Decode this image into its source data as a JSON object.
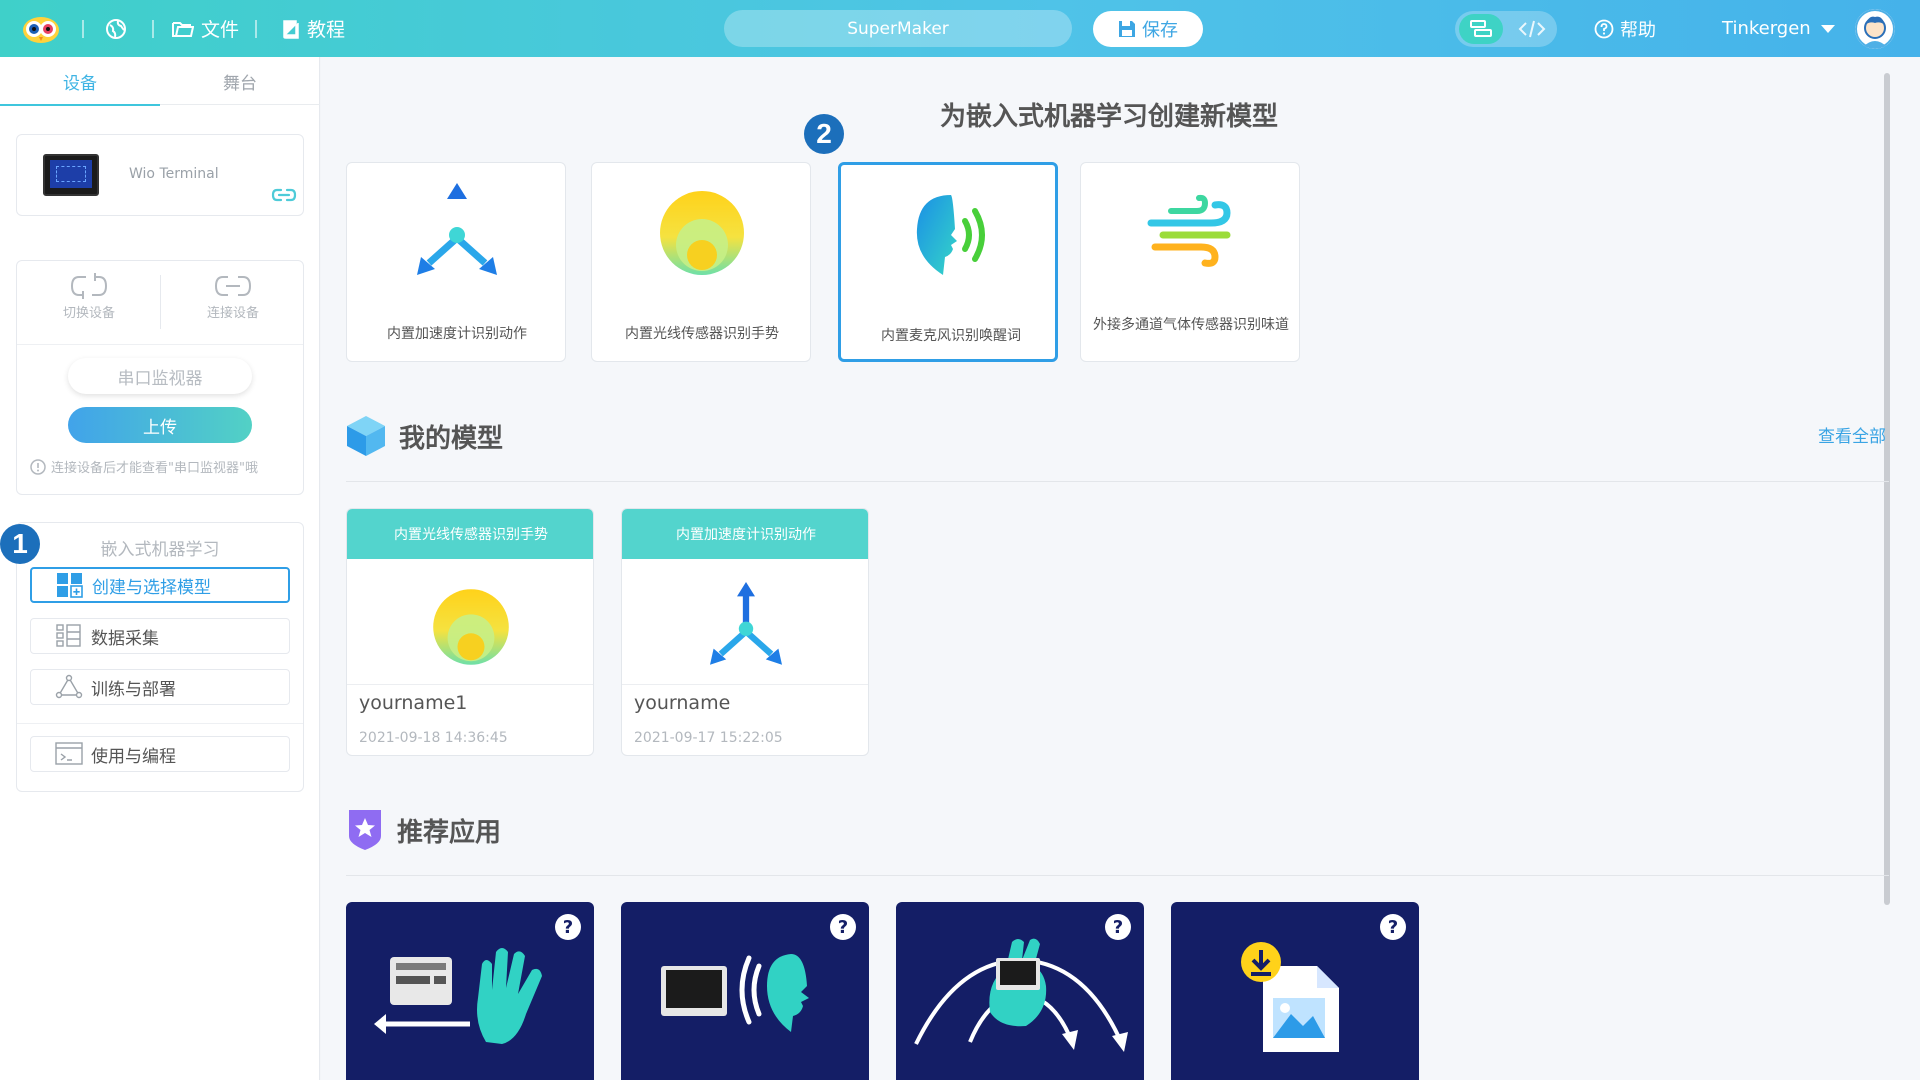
{
  "topbar": {
    "file_label": "文件",
    "tutorial_label": "教程",
    "project_name": "SuperMaker",
    "save_label": "保存",
    "help_label": "帮助",
    "user_name": "Tinkergen"
  },
  "left_panel": {
    "tabs": [
      {
        "label": "设备",
        "active": true
      },
      {
        "label": "舞台",
        "active": false
      }
    ],
    "device": {
      "name": "Wio Terminal"
    },
    "ops": {
      "switch_label": "切换设备",
      "connect_label": "连接设备",
      "serial_label": "串口监视器",
      "upload_label": "上传",
      "hint": "连接设备后才能查看\"串口监视器\"哦"
    },
    "ml": {
      "title": "嵌入式机器学习",
      "items": [
        {
          "label": "创建与选择模型",
          "active": true,
          "icon": "model-grid-icon"
        },
        {
          "label": "数据采集",
          "active": false,
          "icon": "data-list-icon"
        },
        {
          "label": "训练与部署",
          "active": false,
          "icon": "network-icon"
        },
        {
          "label": "使用与编程",
          "active": false,
          "icon": "terminal-icon"
        }
      ]
    }
  },
  "badges": {
    "one": "1",
    "two": "2"
  },
  "main": {
    "create_title": "为嵌入式机器学习创建新模型",
    "templates": [
      {
        "label": "内置加速度计识别动作",
        "icon": "accelerometer-icon"
      },
      {
        "label": "内置光线传感器识别手势",
        "icon": "light-sensor-icon"
      },
      {
        "label": "内置麦克风识别唤醒词",
        "icon": "microphone-voice-icon",
        "selected": true
      },
      {
        "label": "外接多通道气体传感器识别味道",
        "icon": "gas-wind-icon"
      }
    ],
    "my_models_title": "我的模型",
    "view_all": "查看全部",
    "models": [
      {
        "header": "内置光线传感器识别手势",
        "name": "yourname1",
        "date": "2021-09-18 14:36:45",
        "icon": "light-sensor-icon"
      },
      {
        "header": "内置加速度计识别动作",
        "name": "yourname",
        "date": "2021-09-17 15:22:05",
        "icon": "accelerometer-icon"
      }
    ],
    "recommended_title": "推荐应用",
    "apps": [
      {
        "icon": "gesture-hand-icon",
        "help": "?"
      },
      {
        "icon": "voice-device-icon",
        "help": "?"
      },
      {
        "icon": "motion-arc-icon",
        "help": "?"
      },
      {
        "icon": "download-image-icon",
        "help": "?"
      }
    ]
  },
  "colors": {
    "accent": "#2f9ee6",
    "teal": "#53d4cd",
    "badge": "#1c6fbb",
    "app_bg": "#141e66"
  }
}
